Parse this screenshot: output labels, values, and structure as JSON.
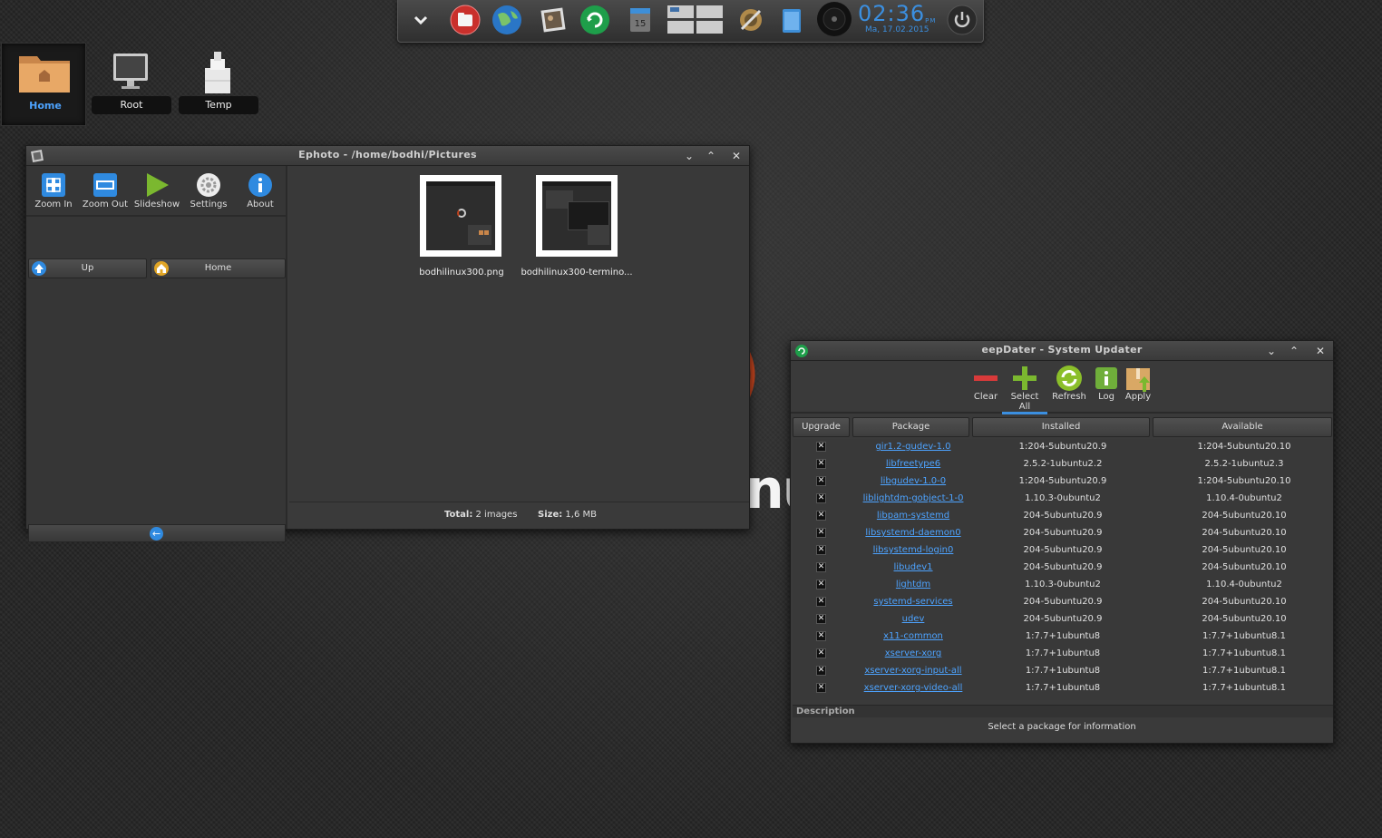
{
  "dock": {
    "clock_time": "02:36",
    "clock_ampm": "PM",
    "clock_date": "Ma, 17.02.2015",
    "calendar_day": "15",
    "icons": [
      "chevron-down-icon",
      "file-manager-icon",
      "web-browser-icon",
      "photo-viewer-icon",
      "updater-icon",
      "calendar-icon",
      "workspace-switcher-icon",
      "system-tools-icon",
      "clipboard-icon",
      "music-player-icon",
      "power-icon"
    ]
  },
  "desktop": {
    "icons": [
      {
        "label": "Home",
        "icon": "home-folder-icon"
      },
      {
        "label": "Root",
        "icon": "monitor-icon"
      },
      {
        "label": "Temp",
        "icon": "temp-folder-icon"
      }
    ],
    "background_logo_fragment": "nu"
  },
  "ephoto": {
    "title": "Ephoto - /home/bodhi/Pictures",
    "toolbar": [
      {
        "label": "Zoom In",
        "icon": "zoom-in-icon"
      },
      {
        "label": "Zoom Out",
        "icon": "zoom-out-icon"
      },
      {
        "label": "Slideshow",
        "icon": "slideshow-icon"
      },
      {
        "label": "Settings",
        "icon": "settings-icon"
      },
      {
        "label": "About",
        "icon": "about-icon"
      }
    ],
    "nav": {
      "up": "Up",
      "home": "Home"
    },
    "files": [
      "bodhilinux300.png",
      "bodhilinux300-termino..."
    ],
    "status": {
      "total_label": "Total:",
      "total_value": "2 images",
      "size_label": "Size:",
      "size_value": "1,6 MB"
    }
  },
  "eepdater": {
    "title": "eepDater - System Updater",
    "toolbar": [
      {
        "label": "Clear",
        "icon": "clear-icon"
      },
      {
        "label": "Select All",
        "icon": "select-all-icon"
      },
      {
        "label": "Refresh",
        "icon": "refresh-icon"
      },
      {
        "label": "Log",
        "icon": "log-icon"
      },
      {
        "label": "Apply",
        "icon": "apply-icon"
      }
    ],
    "columns": {
      "upgrade": "Upgrade",
      "package": "Package",
      "installed": "Installed",
      "available": "Available"
    },
    "packages": [
      {
        "name": "gir1.2-gudev-1.0",
        "installed": "1:204-5ubuntu20.9",
        "available": "1:204-5ubuntu20.10"
      },
      {
        "name": "libfreetype6",
        "installed": "2.5.2-1ubuntu2.2",
        "available": "2.5.2-1ubuntu2.3"
      },
      {
        "name": "libgudev-1.0-0",
        "installed": "1:204-5ubuntu20.9",
        "available": "1:204-5ubuntu20.10"
      },
      {
        "name": "liblightdm-gobject-1-0",
        "installed": "1.10.3-0ubuntu2",
        "available": "1.10.4-0ubuntu2"
      },
      {
        "name": "libpam-systemd",
        "installed": "204-5ubuntu20.9",
        "available": "204-5ubuntu20.10"
      },
      {
        "name": "libsystemd-daemon0",
        "installed": "204-5ubuntu20.9",
        "available": "204-5ubuntu20.10"
      },
      {
        "name": "libsystemd-login0",
        "installed": "204-5ubuntu20.9",
        "available": "204-5ubuntu20.10"
      },
      {
        "name": "libudev1",
        "installed": "204-5ubuntu20.9",
        "available": "204-5ubuntu20.10"
      },
      {
        "name": "lightdm",
        "installed": "1.10.3-0ubuntu2",
        "available": "1.10.4-0ubuntu2"
      },
      {
        "name": "systemd-services",
        "installed": "204-5ubuntu20.9",
        "available": "204-5ubuntu20.10"
      },
      {
        "name": "udev",
        "installed": "204-5ubuntu20.9",
        "available": "204-5ubuntu20.10"
      },
      {
        "name": "x11-common",
        "installed": "1:7.7+1ubuntu8",
        "available": "1:7.7+1ubuntu8.1"
      },
      {
        "name": "xserver-xorg",
        "installed": "1:7.7+1ubuntu8",
        "available": "1:7.7+1ubuntu8.1"
      },
      {
        "name": "xserver-xorg-input-all",
        "installed": "1:7.7+1ubuntu8",
        "available": "1:7.7+1ubuntu8.1"
      },
      {
        "name": "xserver-xorg-video-all",
        "installed": "1:7.7+1ubuntu8",
        "available": "1:7.7+1ubuntu8.1"
      }
    ],
    "check_mark": "✕",
    "description_label": "Description",
    "description_text": "Select a package for information"
  },
  "colors": {
    "accent": "#3b8fe0",
    "link": "#4da3ff",
    "window_bg": "#3a3a3a",
    "titlebar": "#444444"
  }
}
